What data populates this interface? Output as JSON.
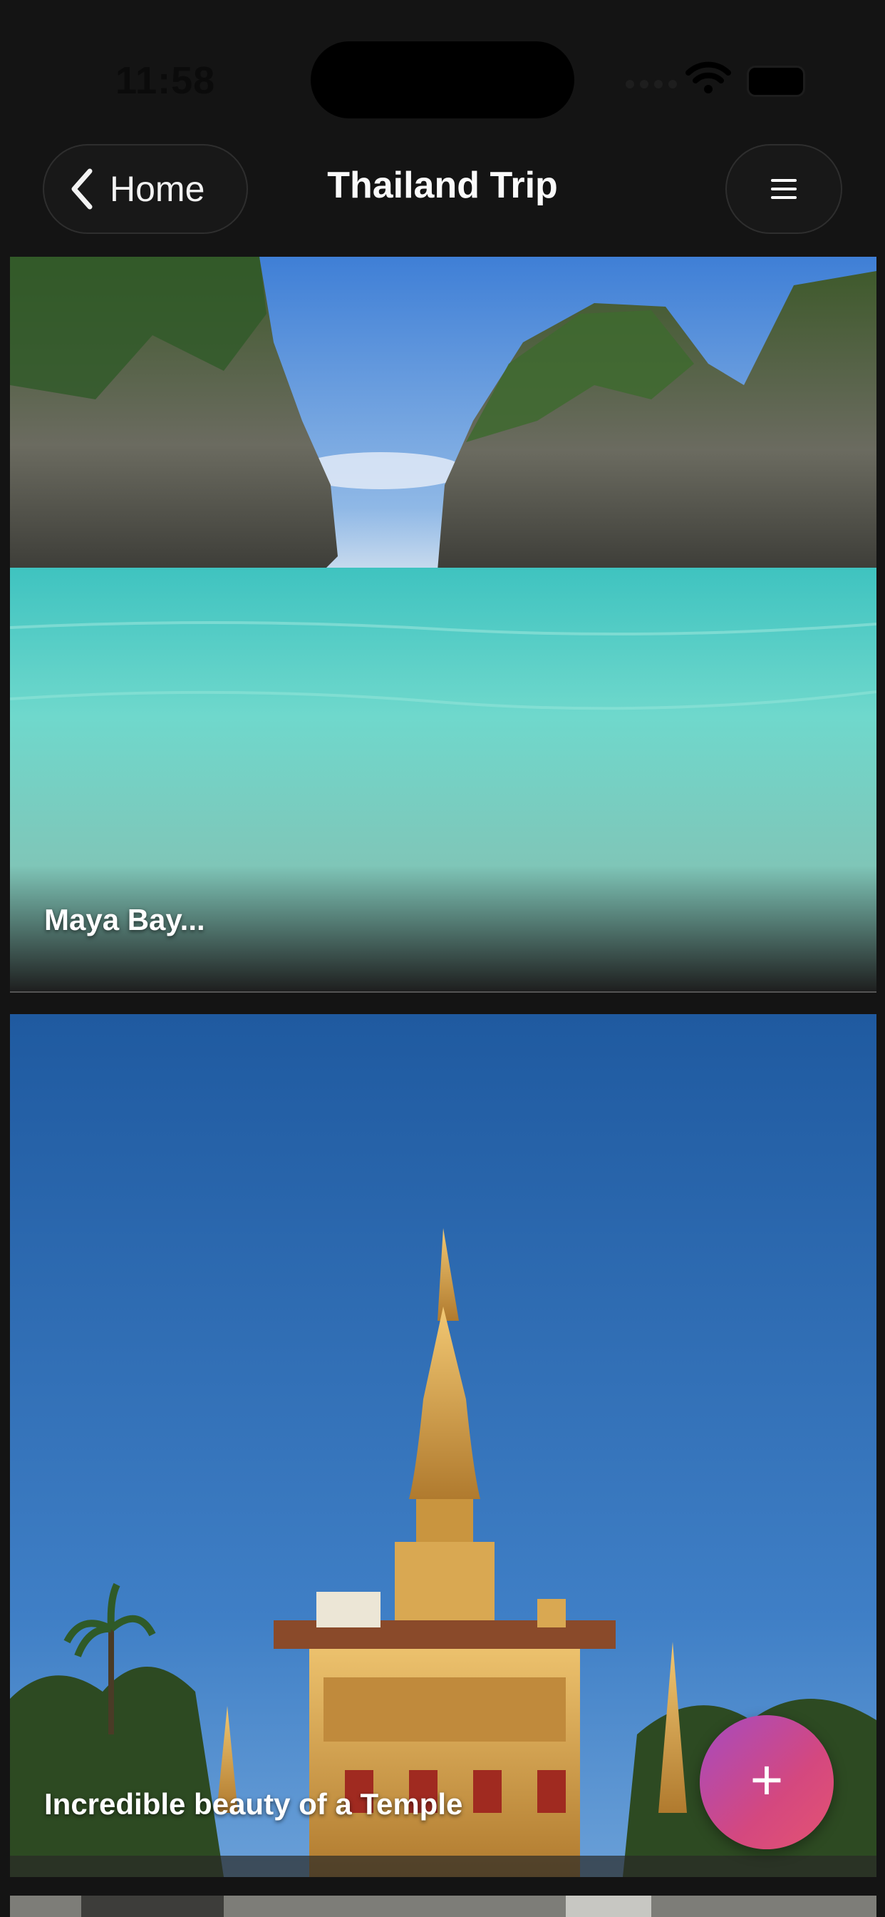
{
  "status_bar": {
    "time": "11:58"
  },
  "header": {
    "back_label": "Home",
    "title": "Thailand Trip"
  },
  "cards": [
    {
      "caption": "Maya Bay..."
    },
    {
      "caption": "Incredible beauty of a Temple"
    }
  ],
  "fab": {
    "label": "+"
  },
  "colors": {
    "background": "#141414",
    "fab_start": "#a64bc0",
    "fab_end": "#e45372"
  }
}
